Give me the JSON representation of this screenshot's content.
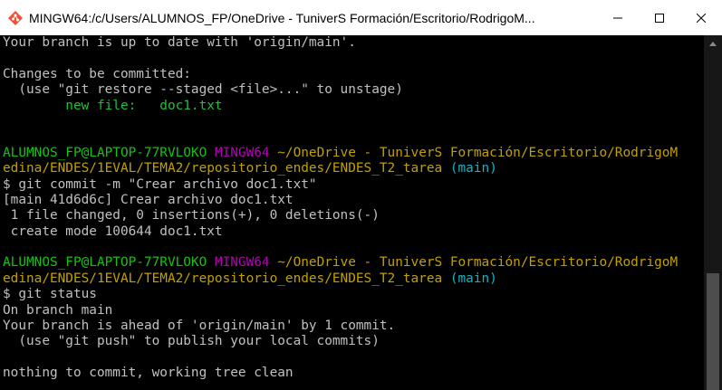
{
  "window": {
    "title": "MINGW64:/c/Users/ALUMNOS_FP/OneDrive - TuniverS Formación/Escritorio/RodrigoM...",
    "icons": {
      "app": "mingw-terminal-icon",
      "minimize": "minimize-icon",
      "maximize": "maximize-icon",
      "close": "close-icon"
    }
  },
  "terminal": {
    "lines": [
      {
        "segments": [
          {
            "text": "Your branch is up to date with 'origin/main'.",
            "color": "default"
          }
        ]
      },
      {
        "segments": [
          {
            "text": "",
            "color": "default"
          }
        ]
      },
      {
        "segments": [
          {
            "text": "Changes to be committed:",
            "color": "default"
          }
        ]
      },
      {
        "segments": [
          {
            "text": "  (use \"git restore --staged <file>...\" to unstage)",
            "color": "default"
          }
        ]
      },
      {
        "segments": [
          {
            "text": "        new file:   doc1.txt",
            "color": "green-file"
          }
        ]
      },
      {
        "segments": [
          {
            "text": "",
            "color": "default"
          }
        ]
      },
      {
        "segments": [
          {
            "text": "",
            "color": "default"
          }
        ]
      },
      {
        "segments": [
          {
            "text": "ALUMNOS_FP@LAPTOP-77RVLOKO ",
            "color": "green"
          },
          {
            "text": "MINGW64 ",
            "color": "magenta"
          },
          {
            "text": "~/OneDrive - TuniverS Formación/Escritorio/RodrigoM",
            "color": "yellow"
          }
        ]
      },
      {
        "segments": [
          {
            "text": "edina/ENDES/1EVAL/TEMA2/repositorio_endes/ENDES_T2_tarea ",
            "color": "yellow"
          },
          {
            "text": "(main)",
            "color": "cyan"
          }
        ]
      },
      {
        "segments": [
          {
            "text": "$ git commit -m \"Crear archivo doc1.txt\"",
            "color": "default"
          }
        ]
      },
      {
        "segments": [
          {
            "text": "[main 41d6d6c] Crear archivo doc1.txt",
            "color": "default"
          }
        ]
      },
      {
        "segments": [
          {
            "text": " 1 file changed, 0 insertions(+), 0 deletions(-)",
            "color": "default"
          }
        ]
      },
      {
        "segments": [
          {
            "text": " create mode 100644 doc1.txt",
            "color": "default"
          }
        ]
      },
      {
        "segments": [
          {
            "text": "",
            "color": "default"
          }
        ]
      },
      {
        "segments": [
          {
            "text": "ALUMNOS_FP@LAPTOP-77RVLOKO ",
            "color": "green"
          },
          {
            "text": "MINGW64 ",
            "color": "magenta"
          },
          {
            "text": "~/OneDrive - TuniverS Formación/Escritorio/RodrigoM",
            "color": "yellow"
          }
        ]
      },
      {
        "segments": [
          {
            "text": "edina/ENDES/1EVAL/TEMA2/repositorio_endes/ENDES_T2_tarea ",
            "color": "yellow"
          },
          {
            "text": "(main)",
            "color": "cyan"
          }
        ]
      },
      {
        "segments": [
          {
            "text": "$ git status",
            "color": "default"
          }
        ]
      },
      {
        "segments": [
          {
            "text": "On branch main",
            "color": "default"
          }
        ]
      },
      {
        "segments": [
          {
            "text": "Your branch is ahead of 'origin/main' by 1 commit.",
            "color": "default"
          }
        ]
      },
      {
        "segments": [
          {
            "text": "  (use \"git push\" to publish your local commits)",
            "color": "default"
          }
        ]
      },
      {
        "segments": [
          {
            "text": "",
            "color": "default"
          }
        ]
      },
      {
        "segments": [
          {
            "text": "nothing to commit, working tree clean",
            "color": "default"
          }
        ]
      }
    ]
  },
  "colors": {
    "default": "#c0c0c0",
    "green": "#13c213",
    "green-file": "#1fbf3a",
    "magenta": "#b300b3",
    "yellow": "#c0a000",
    "cyan": "#13b3c2",
    "background": "#000000",
    "titlebar": "#ffffff"
  },
  "scrollbar": {
    "thumb_position_fraction": 0.67,
    "thumb_size_fraction": 0.33
  }
}
